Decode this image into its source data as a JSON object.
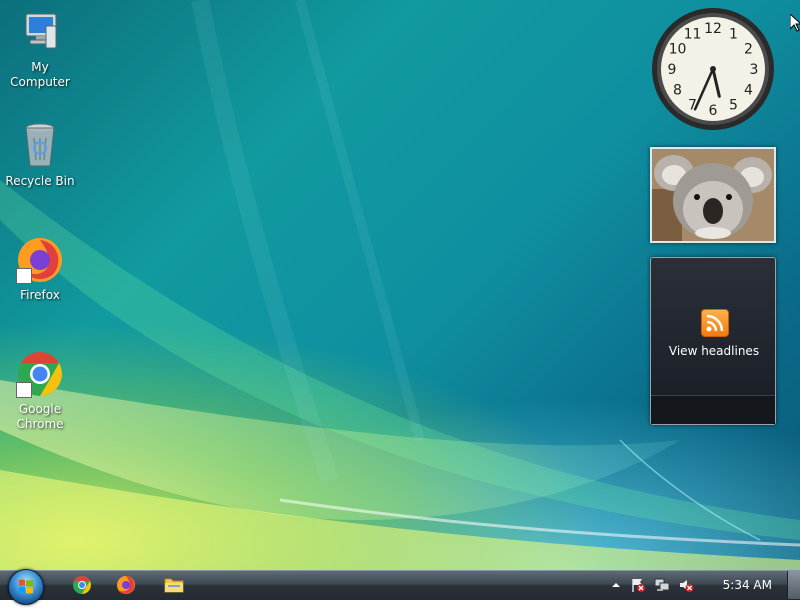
{
  "desktop": {
    "icons": [
      {
        "label": "My Computer",
        "icon": "computer-icon"
      },
      {
        "label": "Recycle Bin",
        "icon": "recycle-bin-icon"
      },
      {
        "label": "Firefox",
        "icon": "firefox-icon"
      },
      {
        "label": "Google\nChrome",
        "icon": "chrome-icon"
      }
    ]
  },
  "gadgets": {
    "clock": {
      "numerals": [
        "12",
        "1",
        "2",
        "3",
        "4",
        "5",
        "6",
        "7",
        "8",
        "9",
        "10",
        "11"
      ],
      "time": "5:34"
    },
    "photo": {
      "subject": "koala-photo"
    },
    "feed": {
      "headline": "View headlines",
      "icon": "rss-icon"
    }
  },
  "taskbar": {
    "start": "start-orb-icon",
    "pinned": [
      "chrome-icon",
      "firefox-icon",
      "file-explorer-icon"
    ],
    "tray": [
      "show-hidden-icons",
      "action-center-flag-icon",
      "network-icon",
      "volume-muted-icon"
    ],
    "clock": "5:34 AM"
  },
  "colors": {
    "wallpaper_teal": "#119a9f",
    "wallpaper_yellow": "#e6f050",
    "taskbar": "#2b323a",
    "feed_bg": "#1e232b",
    "rss": "#f37a10"
  }
}
